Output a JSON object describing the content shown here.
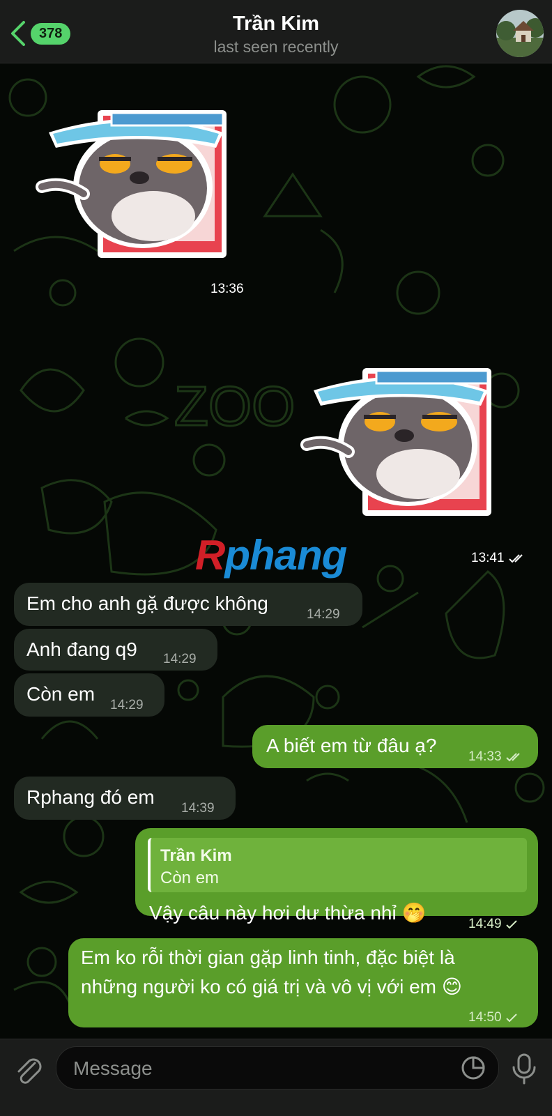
{
  "header": {
    "back_count": "378",
    "contact_name": "Trần Kim",
    "status": "last seen recently"
  },
  "stickers": [
    {
      "time": "13:36",
      "direction": "incoming"
    },
    {
      "time": "13:41",
      "direction": "outgoing",
      "ticks": "read"
    }
  ],
  "watermark": {
    "first": "R",
    "rest": "phang"
  },
  "messages": [
    {
      "direction": "incoming",
      "text": "Em cho anh gặ được không",
      "time": "14:29"
    },
    {
      "direction": "incoming",
      "text": "Anh đang q9",
      "time": "14:29"
    },
    {
      "direction": "incoming",
      "text": "Còn em",
      "time": "14:29"
    },
    {
      "direction": "outgoing",
      "text": "A biết em từ đâu ạ?",
      "time": "14:33",
      "ticks": "read"
    },
    {
      "direction": "incoming",
      "text": "Rphang đó em",
      "time": "14:39"
    },
    {
      "direction": "outgoing",
      "reply_to_name": "Trần Kim",
      "reply_to_text": "Còn em",
      "text": "Vậy câu này hơi dư thừa nhỉ 🤭",
      "time": "14:49",
      "ticks": "sent"
    },
    {
      "direction": "outgoing",
      "text_line1": "Em ko rỗi thời gian gặp linh tinh, đặc biệt là",
      "text_line2": "những người ko có giá trị  và vô vị với em 😊",
      "time": "14:50",
      "ticks": "sent"
    }
  ],
  "composer": {
    "placeholder": "Message"
  },
  "colors": {
    "accent": "#55d36b",
    "outgoing_bubble": "#5a9e2a",
    "incoming_bubble": "#222a22",
    "header": "#1b1c1b"
  }
}
